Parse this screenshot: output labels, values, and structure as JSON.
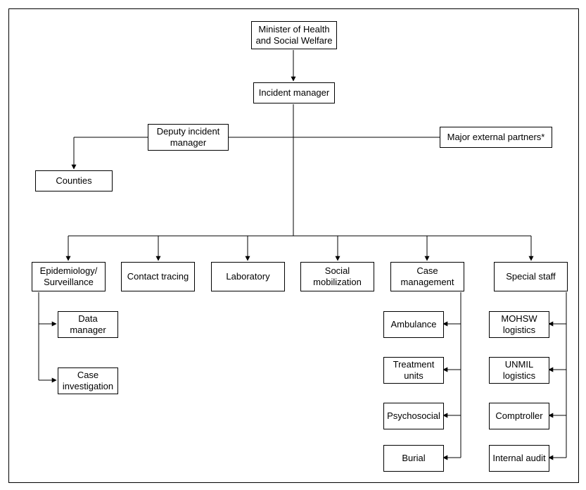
{
  "nodes": {
    "minister": "Minister of Health\nand Social Welfare",
    "incident_manager": "Incident manager",
    "deputy": "Deputy\nincident manager",
    "partners": "Major external partners*",
    "counties": "Counties",
    "epi": "Epidemiology/\nSurveillance",
    "contact": "Contact tracing",
    "lab": "Laboratory",
    "social": "Social\nmobilization",
    "case_mgmt": "Case\nmanagement",
    "special": "Special staff",
    "data_mgr": "Data\nmanager",
    "case_inv": "Case\ninvestigation",
    "ambulance": "Ambulance",
    "treatment": "Treatment\nunits",
    "psychosocial": "Psychosocial",
    "burial": "Burial",
    "mohsw": "MOHSW\nlogistics",
    "unmil": "UNMIL\nlogistics",
    "comptroller": "Comptroller",
    "audit": "Internal\naudit"
  }
}
